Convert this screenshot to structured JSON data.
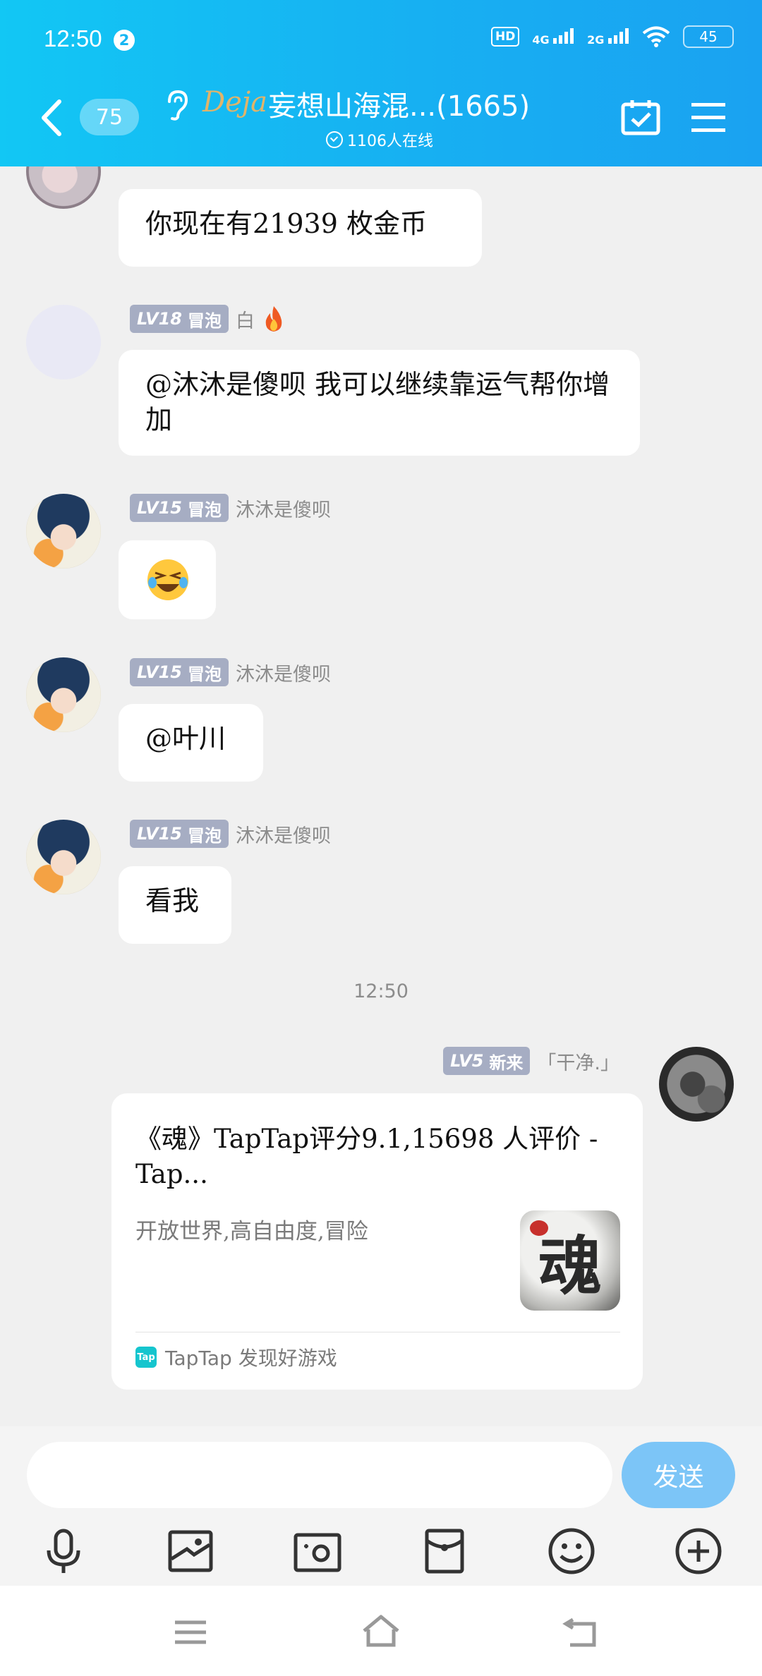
{
  "status_bar": {
    "time": "12:50",
    "notif_count": "2",
    "hd": "HD",
    "hd_sub": "1",
    "net1": "4G",
    "net2": "2G",
    "battery": "45"
  },
  "header": {
    "unread": "75",
    "logo_text": "Deja",
    "title": "妄想山海混...(1665)",
    "online": "1106人在线"
  },
  "messages": [
    {
      "avatar": "white-hair-avatar",
      "text": "你现在有21939 枚金币"
    },
    {
      "level": "LV18",
      "title_badge": "冒泡",
      "nickname": "白",
      "text": "@沐沐是傻呗 我可以继续靠运气帮你增加"
    },
    {
      "level": "LV15",
      "title_badge": "冒泡",
      "nickname": "沐沐是傻呗",
      "emoji": "laughing-crying-emoji"
    },
    {
      "level": "LV15",
      "title_badge": "冒泡",
      "nickname": "沐沐是傻呗",
      "text": "@叶川"
    },
    {
      "level": "LV15",
      "title_badge": "冒泡",
      "nickname": "沐沐是傻呗",
      "text": "看我"
    }
  ],
  "time_separator": "12:50",
  "self_message": {
    "level": "LV5",
    "title_badge": "新来",
    "nickname": "「干净.」",
    "card": {
      "title": "《魂》TapTap评分9.1,15698 人评价 - Tap...",
      "description": "开放世界,高自由度,冒险",
      "thumb_text": "魂",
      "source_logo": "Tap",
      "source": "TapTap 发现好游戏"
    }
  },
  "input": {
    "placeholder": "",
    "send_label": "发送"
  },
  "colors": {
    "header_start": "#12c7f4",
    "header_end": "#1aa2f1",
    "badge": "#a6adc3",
    "send": "#7cc5f7"
  },
  "toolbar_icons": [
    "microphone-icon",
    "image-icon",
    "camera-icon",
    "red-packet-icon",
    "emoji-icon",
    "plus-icon"
  ]
}
